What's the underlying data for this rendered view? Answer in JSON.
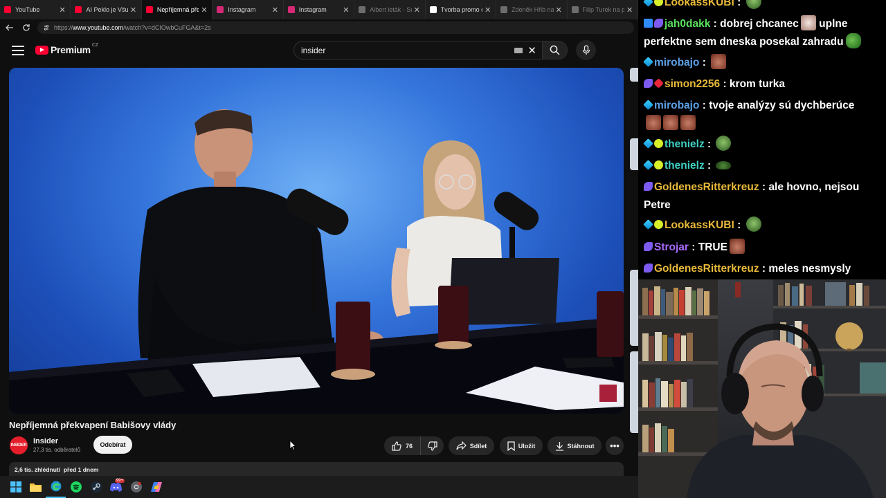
{
  "browser": {
    "tabs": [
      {
        "title": "YouTube",
        "favicon": "youtube-icon",
        "color": "#ff0033",
        "state": "normal"
      },
      {
        "title": "AI Peklo je Všude",
        "favicon": "youtube-icon",
        "color": "#ff0033",
        "state": "normal"
      },
      {
        "title": "Nepříjemná překv",
        "favicon": "youtube-icon",
        "color": "#ff0033",
        "state": "active"
      },
      {
        "title": "Instagram",
        "favicon": "instagram-icon",
        "color": "#d62976",
        "state": "normal"
      },
      {
        "title": "Instagram",
        "favicon": "instagram-icon",
        "color": "#d62976",
        "state": "normal"
      },
      {
        "title": "Albert leták - Sup",
        "favicon": "globe-icon",
        "color": "#6d6d6d",
        "state": "dim"
      },
      {
        "title": "Tvorba promo ob",
        "favicon": "page-icon",
        "color": "#ffffff",
        "state": "normal"
      },
      {
        "title": "Zdeněk Hřib na pl",
        "favicon": "x-icon",
        "color": "#6d6d6d",
        "state": "dim"
      },
      {
        "title": "Filip Turek na pla",
        "favicon": "x-icon",
        "color": "#6d6d6d",
        "state": "dim"
      }
    ],
    "url_prefix": "https://",
    "url_domain": "www.youtube.com",
    "url_rest": "/watch?v=dCIOwbCuFGA&t=2s"
  },
  "youtube": {
    "logo_text": "Premium",
    "logo_region": "CZ",
    "search_value": "insider",
    "video_title": "Nepříjemná překvapení Babišovy vlády",
    "channel": {
      "avatar_text": "INSIDER",
      "name": "Insider",
      "subscribers": "27,3 tis. odběratelů",
      "subscribe_label": "Odebírat"
    },
    "actions": {
      "likes": "76",
      "share_label": "Sdílet",
      "save_label": "Uložit",
      "download_label": "Stáhnout",
      "more_label": "•••"
    },
    "description": {
      "views": "2,6 tis. zhlédnutí",
      "published": "před 1 dnem"
    }
  },
  "chat": {
    "messages": [
      {
        "user": "LookassKUBI",
        "color": "#e8b93a",
        "text": "",
        "badges": [
          "cyan",
          "lime"
        ],
        "emotes": [
          "gob"
        ]
      },
      {
        "user": "jah0dakk",
        "color": "#59e05d",
        "text": "dobrej chcanec",
        "text2": "uplne perfektne sem dneska posekal zahradu",
        "badges": [
          "blue",
          "purple"
        ],
        "emotes": [
          "cat",
          "frog"
        ]
      },
      {
        "user": "mirobajo",
        "color": "#5c9fe5",
        "text": "",
        "badges": [
          "cyan"
        ],
        "emotes": [
          "face"
        ]
      },
      {
        "user": "simon2256",
        "color": "#e8b93a",
        "text": "krom turka",
        "badges": [
          "purple",
          "red"
        ],
        "emotes": []
      },
      {
        "user": "mirobajo",
        "color": "#5c9fe5",
        "text": "tvoje analýzy sú dychberúce",
        "badges": [
          "cyan"
        ],
        "emotes": [
          "face",
          "face",
          "face"
        ]
      },
      {
        "user": "thenielz",
        "color": "#3fd0c3",
        "text": "",
        "badges": [
          "cyan",
          "lime"
        ],
        "emotes": [
          "gob"
        ]
      },
      {
        "user": "thenielz",
        "color": "#3fd0c3",
        "text": "",
        "badges": [
          "cyan",
          "lime"
        ],
        "emotes": [
          "blob"
        ]
      },
      {
        "user": "GoldenesRitterkreuz",
        "color": "#e8b93a",
        "text": "ale hovno, nejsou Petre",
        "badges": [
          "purple"
        ],
        "emotes": []
      },
      {
        "user": "LookassKUBI",
        "color": "#e8b93a",
        "text": "",
        "badges": [
          "cyan",
          "lime"
        ],
        "emotes": [
          "gob"
        ]
      },
      {
        "user": "Strojar",
        "color": "#a86bff",
        "text": "TRUE",
        "badges": [
          "purple"
        ],
        "emotes": [
          "face"
        ]
      },
      {
        "user": "GoldenesRitterkreuz",
        "color": "#e8b93a",
        "text": "meles nesmysly",
        "badges": [
          "purple"
        ],
        "emotes": []
      }
    ]
  },
  "taskbar": {
    "apps": [
      "windows-start-icon",
      "file-explorer-icon",
      "edge-icon",
      "spotify-icon",
      "steam-icon",
      "discord-icon",
      "chrome-icon",
      "copilot-icon"
    ],
    "discord_badge": "99+"
  }
}
